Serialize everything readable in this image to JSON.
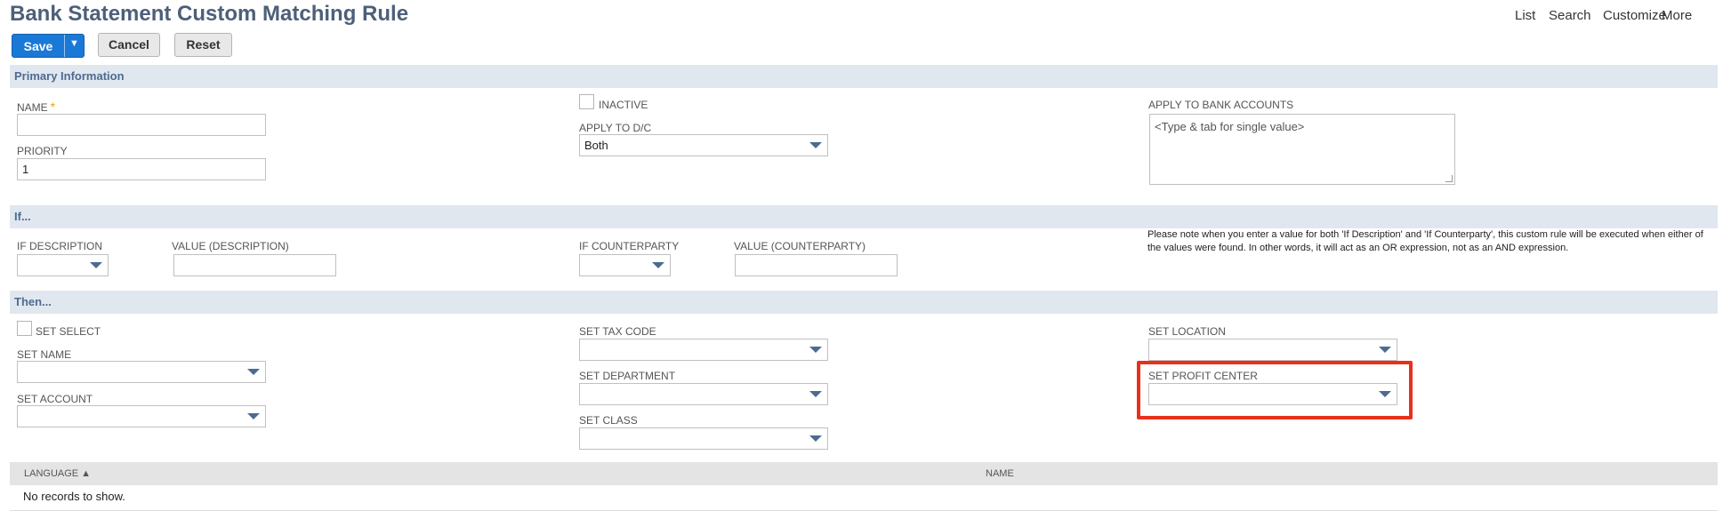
{
  "page": {
    "title": "Bank Statement Custom Matching Rule",
    "top_links": [
      "List",
      "Search",
      "Customize",
      "More"
    ]
  },
  "toolbar": {
    "save_label": "Save",
    "save_caret": "▼",
    "cancel_label": "Cancel",
    "reset_label": "Reset"
  },
  "primary": {
    "header": "Primary Information",
    "name_label": "NAME",
    "name_required": "*",
    "name_value": "",
    "priority_label": "PRIORITY",
    "priority_value": "1",
    "inactive_label": "INACTIVE",
    "apply_dc_label": "APPLY TO D/C",
    "apply_dc_value": "Both",
    "apply_bank_label": "APPLY TO BANK ACCOUNTS",
    "apply_bank_placeholder": "<Type & tab for single value>"
  },
  "if_section": {
    "header": "If...",
    "if_description_label": "IF DESCRIPTION",
    "value_description_label": "VALUE (DESCRIPTION)",
    "if_counterparty_label": "IF COUNTERPARTY",
    "value_counterparty_label": "VALUE (COUNTERPARTY)",
    "note": "Please note when you enter a value for both 'If Description' and 'If Counterparty', this custom rule will be executed when either of the values were found. In other words, it will act as an OR expression, not as an AND expression."
  },
  "then_section": {
    "header": "Then...",
    "set_select_label": "SET SELECT",
    "set_name_label": "SET NAME",
    "set_account_label": "SET ACCOUNT",
    "set_tax_code_label": "SET TAX CODE",
    "set_department_label": "SET DEPARTMENT",
    "set_class_label": "SET CLASS",
    "set_location_label": "SET LOCATION",
    "set_profit_center_label": "SET PROFIT CENTER"
  },
  "list": {
    "col_language": "LANGUAGE ▲",
    "col_name": "NAME",
    "empty_text": "No records to show."
  },
  "colors": {
    "accent": "#1a79d6",
    "section_bg": "#e1e7ef",
    "highlight": "#e8301c"
  }
}
